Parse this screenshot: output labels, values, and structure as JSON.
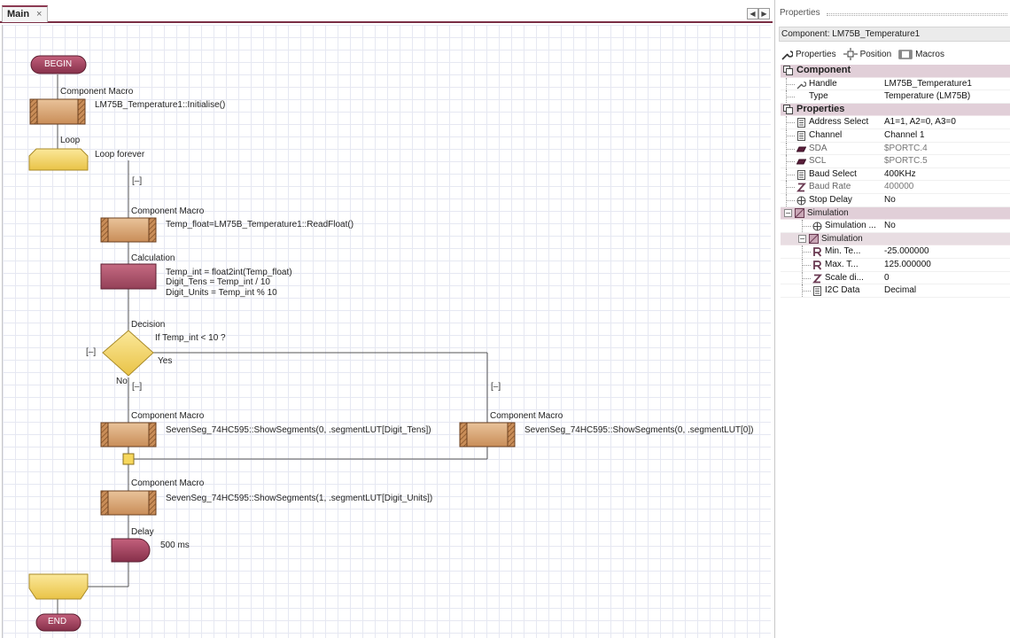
{
  "editor": {
    "tab_label": "Main",
    "tab_close": "×",
    "scroll_left": "◀",
    "scroll_right": "▶"
  },
  "flow": {
    "begin": "BEGIN",
    "end": "END",
    "macro1_title": "Component Macro",
    "macro1_text": "LM75B_Temperature1::Initialise()",
    "loop_title": "Loop",
    "loop_text": "Loop forever",
    "loop_expander": "[–]",
    "macro2_title": "Component Macro",
    "macro2_text": "Temp_float=LM75B_Temperature1::ReadFloat()",
    "calc_title": "Calculation",
    "calc_line1": "Temp_int = float2int(Temp_float)",
    "calc_line2": "Digit_Tens = Temp_int / 10",
    "calc_line3": "Digit_Units = Temp_int % 10",
    "decision_title": "Decision",
    "decision_text": "If  Temp_int < 10 ?",
    "decision_expander": "[–]",
    "yes_label": "Yes",
    "no_label": "No",
    "no_expander": "[–]",
    "yes_expander": "[–]",
    "macro3_title": "Component Macro",
    "macro3_text": "SevenSeg_74HC595::ShowSegments(0, .segmentLUT[Digit_Tens])",
    "macro4_title": "Component Macro",
    "macro4_text": "SevenSeg_74HC595::ShowSegments(0, .segmentLUT[0])",
    "macro5_title": "Component Macro",
    "macro5_text": "SevenSeg_74HC595::ShowSegments(1, .segmentLUT[Digit_Units])",
    "delay_title": "Delay",
    "delay_text": "500 ms"
  },
  "properties": {
    "panel_title": "Properties",
    "component_header": "Component: LM75B_Temperature1",
    "tabs": [
      "Properties",
      "Position",
      "Macros"
    ],
    "section_component": "Component",
    "handle_name": "Handle",
    "handle_value": "LM75B_Temperature1",
    "type_name": "Type",
    "type_value": "Temperature (LM75B)",
    "section_properties": "Properties",
    "rows": [
      {
        "name": "Address Select",
        "value": "A1=1, A2=0, A3=0",
        "dim": false,
        "icon": "list-icon"
      },
      {
        "name": "Channel",
        "value": "Channel 1",
        "dim": false,
        "icon": "list-icon"
      },
      {
        "name": "SDA",
        "value": "$PORTC.4",
        "dim": true,
        "icon": "pin-icon"
      },
      {
        "name": "SCL",
        "value": "$PORTC.5",
        "dim": true,
        "icon": "pin-icon"
      },
      {
        "name": "Baud Select",
        "value": "400KHz",
        "dim": false,
        "icon": "list-icon"
      },
      {
        "name": "Baud Rate",
        "value": "400000",
        "dim": true,
        "icon": "integer-icon"
      },
      {
        "name": "Stop Delay",
        "value": "No",
        "dim": false,
        "icon": "toggle-icon"
      }
    ],
    "section_simulation": "Simulation",
    "sim_name": "Simulation ...",
    "sim_value": "No",
    "subsection_simulation": "Simulation",
    "sim_rows": [
      {
        "name": "Min. Te...",
        "value": "-25.000000",
        "icon": "real-icon"
      },
      {
        "name": "Max. T...",
        "value": "125.000000",
        "icon": "real-icon"
      },
      {
        "name": "Scale di...",
        "value": "0",
        "icon": "integer-icon"
      },
      {
        "name": "I2C Data",
        "value": "Decimal",
        "icon": "list-icon"
      }
    ]
  },
  "colors": {
    "accent": "#7a2e44",
    "section_bg": "#e1cfd8",
    "macro_fill": "#d9a877",
    "calc_fill": "#b0566f",
    "loop_fill": "#f3d46a",
    "terminal_fill": "#9e3b57"
  }
}
